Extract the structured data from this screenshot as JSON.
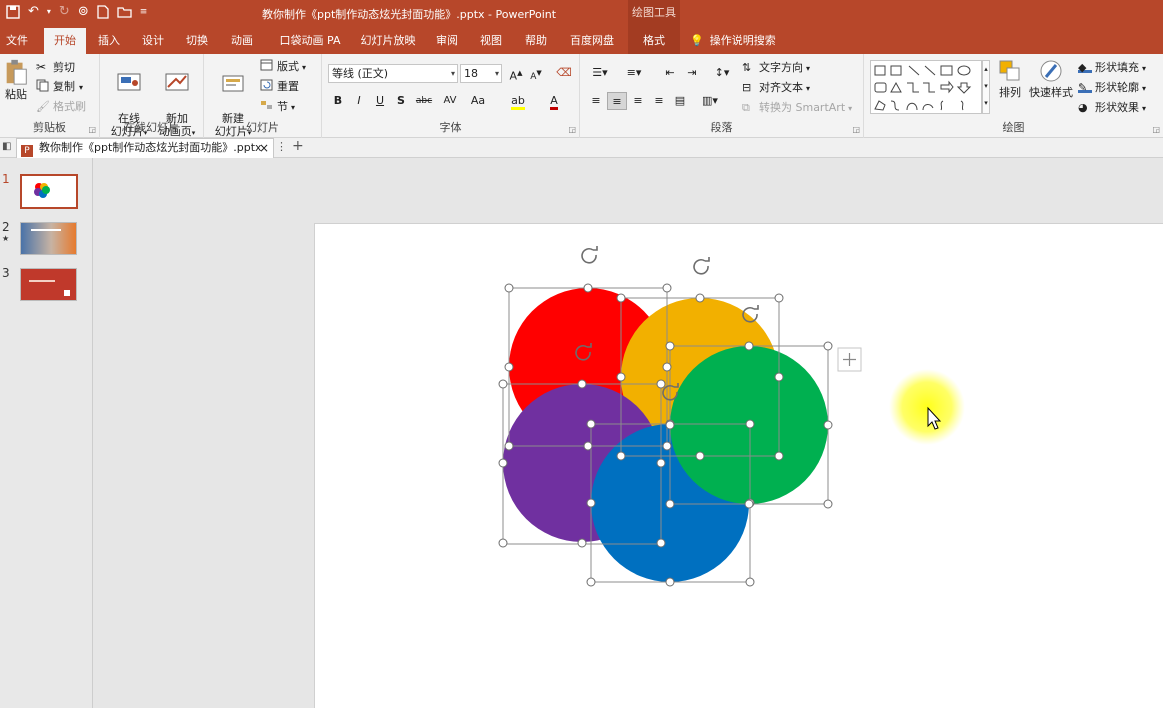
{
  "window": {
    "doc_title": "教你制作《ppt制作动态炫光封面功能》.pptx  -  PowerPoint",
    "context_tab_title": "绘图工具"
  },
  "tabs": [
    "文件",
    "开始",
    "插入",
    "设计",
    "切换",
    "动画",
    "口袋动画 PA",
    "幻灯片放映",
    "审阅",
    "视图",
    "帮助",
    "百度网盘",
    "格式",
    "操作说明搜索"
  ],
  "ribbon": {
    "clipboard": {
      "paste": "粘贴",
      "cut": "剪切",
      "copy": "复制",
      "format_painter": "格式刷",
      "label": "剪贴板"
    },
    "online": {
      "online_slide": "在线\n幻灯片",
      "new_anim": "新加\n动画页",
      "label": "在线幻灯片"
    },
    "slides": {
      "new_slide": "新建\n幻灯片",
      "layout": "版式",
      "reset": "重置",
      "section": "节",
      "label": "幻灯片"
    },
    "font": {
      "font_name": "等线 (正文)",
      "font_size": "18",
      "label": "字体",
      "buttons": [
        "B",
        "I",
        "U",
        "S",
        "abc",
        "AV",
        "Aa",
        "A"
      ]
    },
    "paragraph": {
      "text_direction": "文字方向",
      "align_text": "对齐文本",
      "smartart": "转换为 SmartArt",
      "label": "段落"
    },
    "drawing": {
      "arrange": "排列",
      "quick_styles": "快速样式",
      "shape_fill": "形状填充",
      "shape_outline": "形状轮廓",
      "shape_effects": "形状效果",
      "label": "绘图"
    }
  },
  "document_tab": {
    "name": "教你制作《ppt制作动态炫光封面功能》.pptx"
  },
  "thumbnails": [
    {
      "num": "1",
      "mark": ""
    },
    {
      "num": "2",
      "mark": "★"
    },
    {
      "num": "3",
      "mark": ""
    }
  ],
  "slide": {
    "circles": [
      {
        "name": "red",
        "color": "#ff0000"
      },
      {
        "name": "orange",
        "color": "#f2b000"
      },
      {
        "name": "purple",
        "color": "#7030a0"
      },
      {
        "name": "blue",
        "color": "#0070c0"
      },
      {
        "name": "green",
        "color": "#00b050"
      }
    ]
  },
  "colors": {
    "accent": "#b7472a",
    "accent_dark": "#a33c22",
    "cursor_highlight": "#ffff00"
  }
}
